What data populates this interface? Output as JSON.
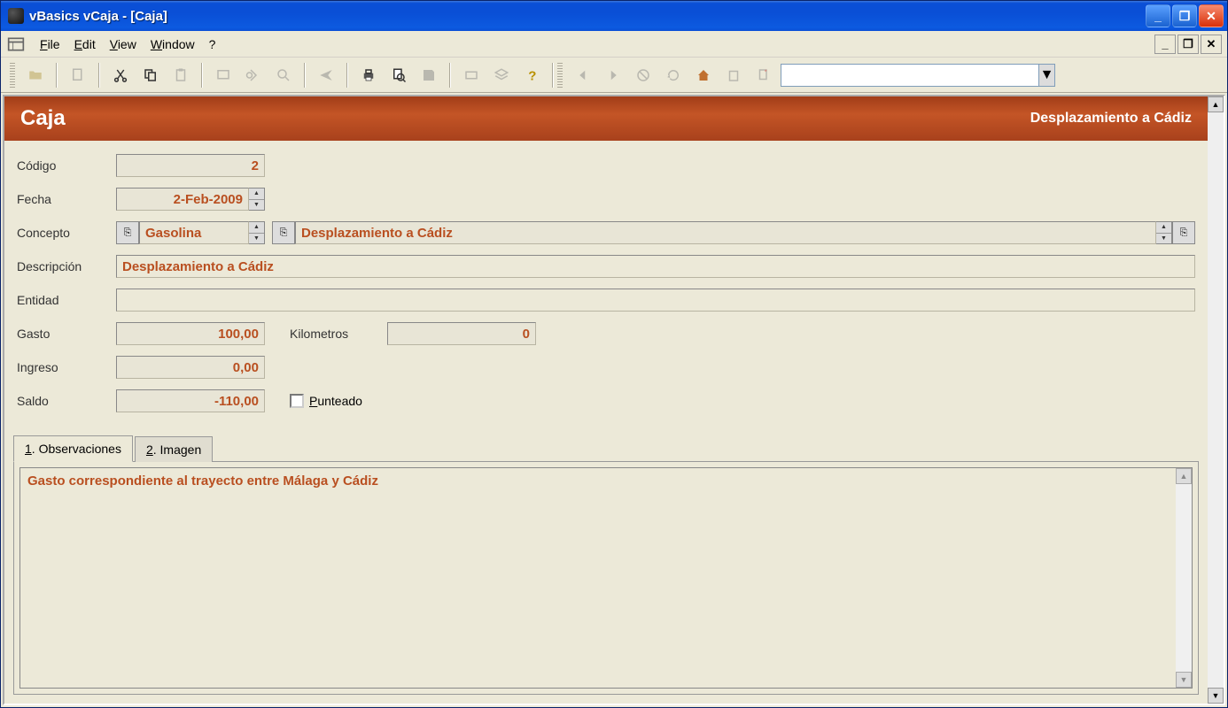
{
  "window": {
    "title": "vBasics vCaja - [Caja]"
  },
  "menu": {
    "file": "File",
    "edit": "Edit",
    "view": "View",
    "window": "Window",
    "help": "?"
  },
  "header": {
    "title": "Caja",
    "subtitle": "Desplazamiento a Cádiz"
  },
  "form": {
    "codigo_label": "Código",
    "codigo": "2",
    "fecha_label": "Fecha",
    "fecha": "2-Feb-2009",
    "concepto_label": "Concepto",
    "concepto1": "Gasolina",
    "concepto2": "Desplazamiento a Cádiz",
    "descripcion_label": "Descripción",
    "descripcion": "Desplazamiento a Cádiz",
    "entidad_label": "Entidad",
    "entidad": "",
    "gasto_label": "Gasto",
    "gasto": "100,00",
    "kilometros_label": "Kilometros",
    "kilometros": "0",
    "ingreso_label": "Ingreso",
    "ingreso": "0,00",
    "saldo_label": "Saldo",
    "saldo": "-110,00",
    "punteado_label": "Punteado"
  },
  "tabs": {
    "t1": "1. Observaciones",
    "t2": "2. Imagen"
  },
  "observaciones": "Gasto correspondiente al trayecto entre Málaga y Cádiz"
}
